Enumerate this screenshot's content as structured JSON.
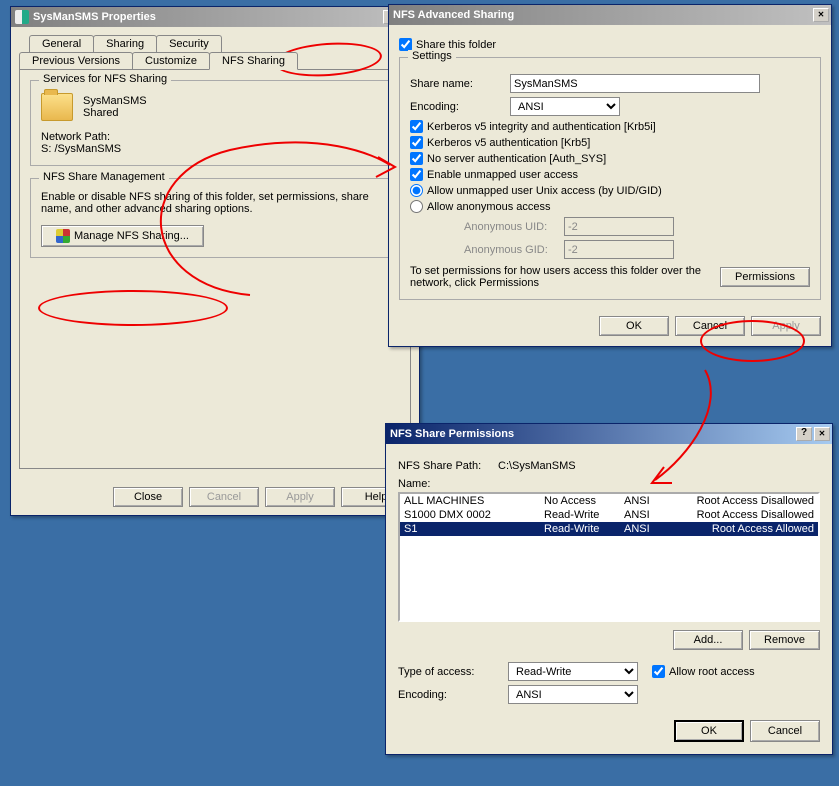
{
  "properties_dialog": {
    "title": "SysManSMS Properties",
    "tabs_row1": [
      "General",
      "Sharing",
      "Security"
    ],
    "tabs_row2": [
      "Previous Versions",
      "Customize",
      "NFS Sharing"
    ],
    "services_group": "Services for NFS Sharing",
    "folder_name": "SysManSMS",
    "folder_status": "Shared",
    "network_path_label": "Network Path:",
    "network_path_value": "S:                  /SysManSMS",
    "mgmt_group": "NFS Share Management",
    "mgmt_desc": "Enable or disable NFS sharing of this folder, set permissions, share name, and other advanced sharing options.",
    "manage_btn": "Manage NFS Sharing...",
    "buttons": {
      "close": "Close",
      "cancel": "Cancel",
      "apply": "Apply",
      "help": "Help"
    }
  },
  "advanced_dialog": {
    "title": "NFS Advanced Sharing",
    "share_this": "Share this folder",
    "settings_group": "Settings",
    "share_name_label": "Share name:",
    "share_name_value": "SysManSMS",
    "encoding_label": "Encoding:",
    "encoding_value": "ANSI",
    "krb5i": "Kerberos v5 integrity and authentication [Krb5i]",
    "krb5": "Kerberos v5 authentication [Krb5]",
    "auth_sys": "No server authentication [Auth_SYS]",
    "enable_unmapped": "Enable unmapped user access",
    "allow_uid": "Allow unmapped user Unix access (by UID/GID)",
    "allow_anon": "Allow anonymous access",
    "anon_uid_label": "Anonymous UID:",
    "anon_uid_value": "-2",
    "anon_gid_label": "Anonymous GID:",
    "anon_gid_value": "-2",
    "perm_text": "To set permissions for how users access this folder over the network, click Permissions",
    "permissions_btn": "Permissions",
    "buttons": {
      "ok": "OK",
      "cancel": "Cancel",
      "apply": "Apply"
    }
  },
  "perm_dialog": {
    "title": "NFS Share Permissions",
    "nfs_path_label": "NFS Share Path:",
    "nfs_path_value": "C:\\SysManSMS",
    "name_label": "Name:",
    "rows": [
      {
        "name": "ALL MACHINES",
        "access": "No Access",
        "enc": "ANSI",
        "root": "Root Access Disallowed"
      },
      {
        "name": "S1000 DMX 0002",
        "access": "Read-Write",
        "enc": "ANSI",
        "root": "Root Access Disallowed"
      },
      {
        "name": "S1",
        "access": "Read-Write",
        "enc": "ANSI",
        "root": "Root Access Allowed"
      }
    ],
    "add_btn": "Add...",
    "remove_btn": "Remove",
    "type_label": "Type of access:",
    "type_value": "Read-Write",
    "allow_root": "Allow root access",
    "encoding_label": "Encoding:",
    "encoding_value": "ANSI",
    "buttons": {
      "ok": "OK",
      "cancel": "Cancel"
    }
  }
}
